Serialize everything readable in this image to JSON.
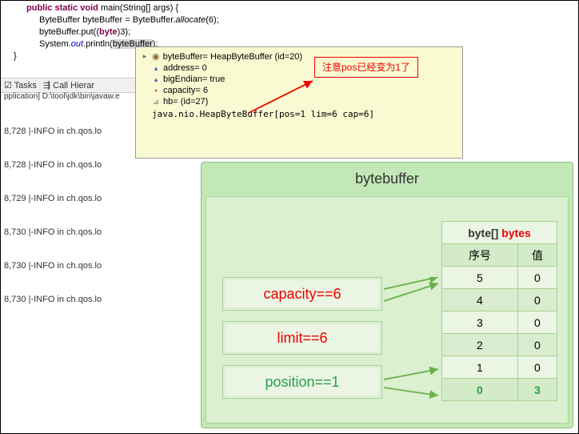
{
  "code": {
    "line1_kw1": "public",
    "line1_kw2": "static",
    "line1_kw3": "void",
    "line1_method": "main",
    "line1_rest": "(String[] args) {",
    "line2a": "ByteBuffer byteBuffer = ByteBuffer.",
    "line2_method": "allocate",
    "line2b": "(6);",
    "line3a": "byteBuffer.put((",
    "line3_kw": "byte",
    "line3b": ")3);",
    "line4a": "System.",
    "line4_out": "out",
    "line4b": ".println(",
    "line4_var": "byteBuffer",
    "line4c": ");",
    "brace": "}"
  },
  "tabs": {
    "tasks": "Tasks",
    "call_hier": "Call Hierar"
  },
  "path": "pplication] D:\\tool\\jdk\\bin\\javaw.e",
  "console_lines": [
    "8,728 |-INFO in ch.qos.lo",
    "8,728 |-INFO in ch.qos.lo",
    "8,729 |-INFO in ch.qos.lo",
    "8,730 |-INFO in ch.qos.lo",
    "8,730 |-INFO in ch.qos.lo",
    "8,730 |-INFO in ch.qos.lo"
  ],
  "debug": {
    "root": "byteBuffer= HeapByteBuffer  (id=20)",
    "address": "address= 0",
    "bigEndian": "bigEndian= true",
    "capacity": "capacity= 6",
    "hb": "hb= (id=27)",
    "toString": "java.nio.HeapByteBuffer[pos=1 lim=6 cap=6]"
  },
  "annotation": "注意pos已经变为1了",
  "diagram": {
    "title": "bytebuffer",
    "capacity_label": "capacity==6",
    "limit_label": "limit==6",
    "position_label": "position==1",
    "bytes_header_black": "byte[] ",
    "bytes_header_red": "bytes",
    "col1": "序号",
    "col2": "值",
    "rows": [
      {
        "idx": "5",
        "val": "0"
      },
      {
        "idx": "4",
        "val": "0"
      },
      {
        "idx": "3",
        "val": "0"
      },
      {
        "idx": "2",
        "val": "0"
      },
      {
        "idx": "1",
        "val": "0"
      },
      {
        "idx": "0",
        "val": "3"
      }
    ]
  },
  "chart_data": {
    "type": "table",
    "title": "bytebuffer",
    "bytes": [
      {
        "index": 5,
        "value": 0
      },
      {
        "index": 4,
        "value": 0
      },
      {
        "index": 3,
        "value": 0
      },
      {
        "index": 2,
        "value": 0
      },
      {
        "index": 1,
        "value": 0
      },
      {
        "index": 0,
        "value": 3
      }
    ],
    "capacity": 6,
    "limit": 6,
    "position": 1
  }
}
